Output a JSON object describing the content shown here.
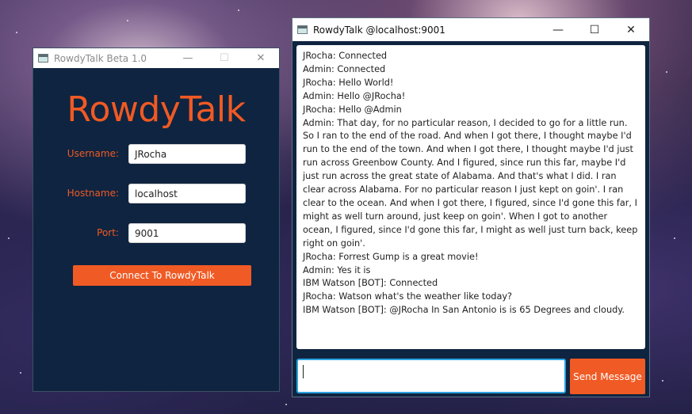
{
  "login_window": {
    "title": "RowdyTalk Beta 1.0",
    "logo_text": "RowdyTalk",
    "username_label": "Username:",
    "username_value": "JRocha",
    "hostname_label": "Hostname:",
    "hostname_value": "localhost",
    "port_label": "Port:",
    "port_value": "9001",
    "connect_label": "Connect To RowdyTalk",
    "controls": {
      "minimize": "—",
      "maximize": "☐",
      "close": "✕"
    }
  },
  "chat_window": {
    "title": "RowdyTalk @localhost:9001",
    "controls": {
      "minimize": "—",
      "maximize": "☐",
      "close": "✕"
    },
    "messages": [
      "JRocha: Connected",
      "Admin: Connected",
      "JRocha: Hello World!",
      "Admin: Hello @JRocha!",
      "JRocha: Hello @Admin",
      "Admin:  That day, for no particular reason, I decided to go for a little run. So I ran to the end of the road. And when I got there, I thought maybe I'd run to the end of the town. And when I got there, I thought maybe I'd just run across Greenbow County. And I figured, since run this far, maybe I'd just run across the great state of Alabama. And that's what I did. I ran clear across Alabama. For no particular reason I just kept on goin'. I ran clear to the ocean. And when I got there, I figured, since I'd gone this far, I might as well turn around, just keep on goin'. When I got to another ocean, I figured, since I'd gone this far, I might as well just turn back, keep right on goin'.",
      "JRocha: Forrest Gump is a great movie!",
      "Admin: Yes it is",
      "IBM Watson [BOT]: Connected",
      "JRocha: Watson what's the weather like today?",
      "IBM Watson [BOT]: @JRocha In San Antonio is is 65 Degrees and cloudy."
    ],
    "message_input_value": "",
    "send_label": "Send Message"
  },
  "colors": {
    "accent": "#f05a24",
    "window_bg": "#0f2440",
    "focus_border": "#2ba2e0"
  }
}
